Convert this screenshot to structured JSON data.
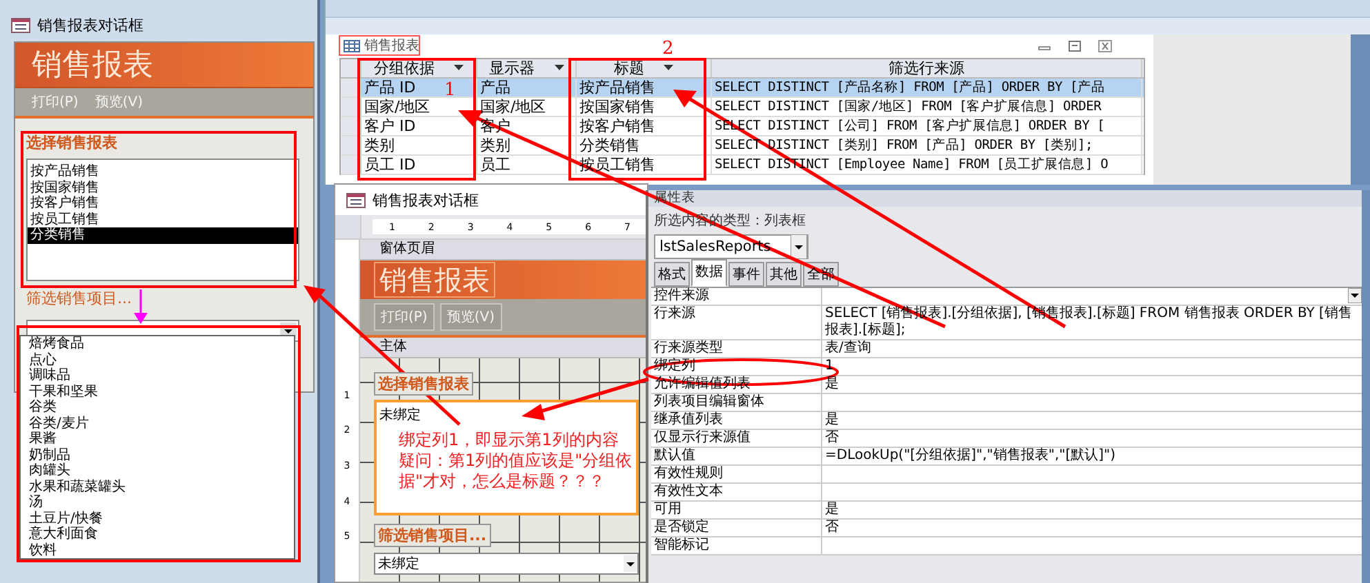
{
  "dialog": {
    "title": "销售报表对话框",
    "header": "销售报表",
    "toolbar": [
      "打印(P)",
      "预览(V)"
    ],
    "report_label": "选择销售报表",
    "reports": [
      {
        "label": "按产品销售",
        "selected": false
      },
      {
        "label": "按国家销售",
        "selected": false
      },
      {
        "label": "按客户销售",
        "selected": false
      },
      {
        "label": "按员工销售",
        "selected": false
      },
      {
        "label": "分类销售",
        "selected": true
      }
    ],
    "filter_label": "筛选销售项目...",
    "filter_options": [
      "焙烤食品",
      "点心",
      "调味品",
      "干果和坚果",
      "谷类",
      "谷类/麦片",
      "果酱",
      "奶制品",
      "肉罐头",
      "水果和蔬菜罐头",
      "汤",
      "土豆片/快餐",
      "意大利面食",
      "饮料"
    ]
  },
  "datasheet": {
    "tab": "销售报表",
    "columns": [
      "分组依据",
      "显示器",
      "标题",
      "筛选行来源"
    ],
    "rows": [
      {
        "cells": [
          "产品 ID",
          "产品",
          "按产品销售",
          "SELECT DISTINCT [产品名称] FROM [产品] ORDER BY [产品"
        ],
        "selected": true
      },
      {
        "cells": [
          "国家/地区",
          "国家/地区",
          "按国家销售",
          "SELECT DISTINCT [国家/地区] FROM [客户扩展信息] ORDER"
        ],
        "selected": false
      },
      {
        "cells": [
          "客户 ID",
          "客户",
          "按客户销售",
          "SELECT DISTINCT [公司] FROM [客户扩展信息] ORDER BY ["
        ],
        "selected": false
      },
      {
        "cells": [
          "类别",
          "类别",
          "分类销售",
          "SELECT DISTINCT [类别] FROM [产品] ORDER BY [类别];"
        ],
        "selected": false
      },
      {
        "cells": [
          "员工 ID",
          "员工",
          "按员工销售",
          "SELECT DISTINCT [Employee Name] FROM [员工扩展信息] O"
        ],
        "selected": false
      }
    ]
  },
  "design": {
    "title": "销售报表对话框",
    "ruler": [
      "1",
      "2",
      "3",
      "4",
      "5",
      "6",
      "7"
    ],
    "side_ruler": [
      "1",
      "2",
      "3",
      "4",
      "5"
    ],
    "header_section": "窗体页眉",
    "header": "销售报表",
    "buttons": [
      "打印(P)",
      "预览(V)"
    ],
    "body_section": "主体",
    "list_label": "选择销售报表",
    "list_value": "未绑定",
    "filter_label": "筛选销售项目...",
    "combo_value": "未绑定"
  },
  "properties": {
    "title": "属性表",
    "selection_type": "所选内容的类型：列表框",
    "object": "lstSalesReports",
    "tabs": [
      {
        "label": "格式",
        "selected": false
      },
      {
        "label": "数据",
        "selected": true
      },
      {
        "label": "事件",
        "selected": false
      },
      {
        "label": "其他",
        "selected": false
      },
      {
        "label": "全部",
        "selected": false
      }
    ],
    "rows": [
      {
        "name": "控件来源"
      },
      {
        "name": "行来源",
        "value": "SELECT [销售报表].[分组依据], [销售报表].[标题] FROM 销售报表 ORDER BY [销售报表].[标题];"
      },
      {
        "name": "行来源类型",
        "value": "表/查询"
      },
      {
        "name": "绑定列",
        "value": "1"
      },
      {
        "name": "允许编辑值列表",
        "value": "是"
      },
      {
        "name": "列表项目编辑窗体"
      },
      {
        "name": "继承值列表",
        "value": "是"
      },
      {
        "name": "仅显示行来源值",
        "value": "否"
      },
      {
        "name": "默认值",
        "value": "=DLookUp(\"[分组依据]\",\"销售报表\",\"[默认]\")"
      },
      {
        "name": "有效性规则"
      },
      {
        "name": "有效性文本"
      },
      {
        "name": "可用",
        "value": "是"
      },
      {
        "name": "是否锁定",
        "value": "否"
      },
      {
        "name": "智能标记"
      }
    ]
  },
  "annotations": {
    "markers": [
      "1",
      "2"
    ],
    "note": "绑定列1，即显示第1列的内容疑问：第1列的值应该是\"分组依据\"才对，怎么是标题？？？"
  }
}
